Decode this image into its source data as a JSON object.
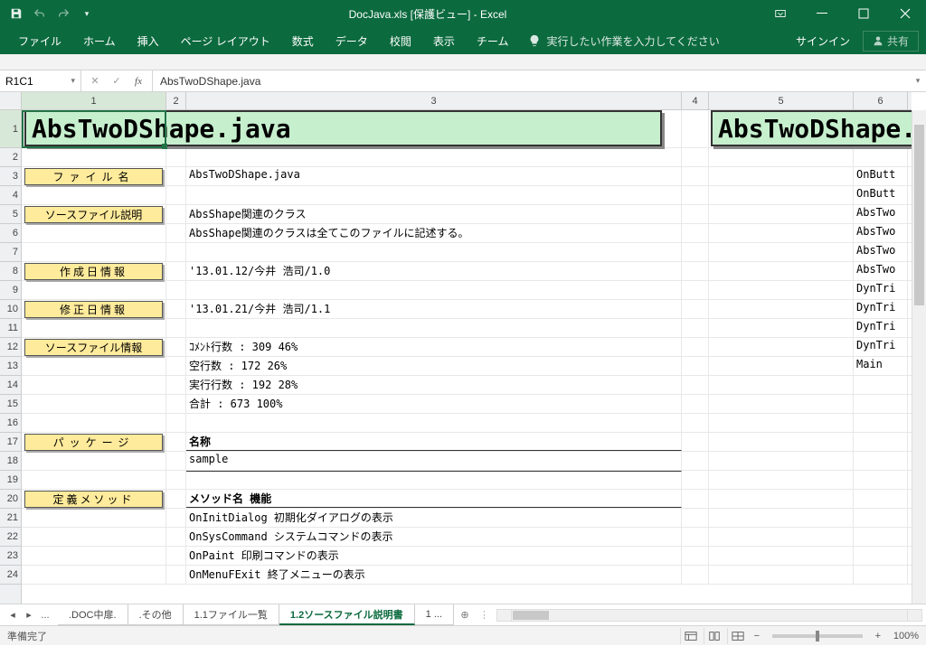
{
  "titlebar": {
    "title": "DocJava.xls  [保護ビュー] - Excel"
  },
  "ribbon": {
    "tabs": [
      "ファイル",
      "ホーム",
      "挿入",
      "ページ レイアウト",
      "数式",
      "データ",
      "校閲",
      "表示",
      "チーム"
    ],
    "tell_me": "実行したい作業を入力してください",
    "signin": "サインイン",
    "share": "共有"
  },
  "formula": {
    "name_box": "R1C1",
    "value": "AbsTwoDShape.java"
  },
  "columns": [
    "1",
    "2",
    "3",
    "4",
    "5",
    "6"
  ],
  "rows": [
    "1",
    "2",
    "3",
    "4",
    "5",
    "6",
    "7",
    "8",
    "9",
    "10",
    "11",
    "12",
    "13",
    "14",
    "15",
    "16",
    "17",
    "18",
    "19",
    "20",
    "21",
    "22",
    "23",
    "24"
  ],
  "sections": {
    "file_name": "ファイル名",
    "source_desc": "ソースファイル説明",
    "create_date": "作成日情報",
    "modify_date": "修正日情報",
    "source_info": "ソースファイル情報",
    "package": "パッケージ",
    "methods": "定義メソッド"
  },
  "content": {
    "big_title": "AbsTwoDShape.java",
    "big_title2": "AbsTwoDShape.j",
    "file_name_val": "AbsTwoDShape.java",
    "desc1": "AbsShape関連のクラス",
    "desc2": "AbsShape関連のクラスは全てこのファイルに記述する。",
    "create_val": "'13.01.12/今井 浩司/1.0",
    "modify_val": "'13.01.21/今井 浩司/1.1",
    "stats1": "ｺﾒﾝﾄ行数  :    309    46%",
    "stats2": "空行数    :    172    26%",
    "stats3": "実行行数  :    192    28%",
    "stats4": "合計      :    673   100%",
    "pkg_header": "名称",
    "pkg_val": "sample",
    "meth_header": "メソッド名    機能",
    "m1": "OnInitDialog 初期化ダイアログの表示",
    "m2": "OnSysCommand システムコマンドの表示",
    "m3": "OnPaint      印刷コマンドの表示",
    "m4": "OnMenuFExit  終了メニューの表示"
  },
  "col5": [
    "OnButt",
    "OnButt",
    "AbsTwo",
    "AbsTwo",
    "AbsTwo",
    "AbsTwo",
    "DynTri",
    "DynTri",
    "DynTri",
    "DynTri",
    "Main"
  ],
  "sheets": {
    "tabs": [
      ".DOC中扉.",
      ".その他",
      "1.1ファイル一覧",
      "1.2ソースファイル説明書",
      "1 ..."
    ],
    "active": 3,
    "more": "..."
  },
  "status": {
    "ready": "準備完了",
    "zoom": "100%"
  }
}
